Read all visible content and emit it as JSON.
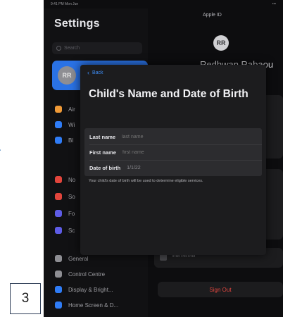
{
  "status_bar": {
    "left": "9:41 PM Mon Jun",
    "right": "•••"
  },
  "sidebar": {
    "title": "Settings",
    "search_placeholder": "Search",
    "profile_initials": "RR",
    "rows_top": [
      {
        "label": "Air",
        "color": "#f09a37"
      },
      {
        "label": "Wi",
        "color": "#2f7cf6"
      },
      {
        "label": "Bl",
        "color": "#2f7cf6"
      }
    ],
    "rows_mid": [
      {
        "label": "No",
        "color": "#e2453c"
      },
      {
        "label": "So",
        "color": "#e2453c"
      },
      {
        "label": "Fo",
        "color": "#5e5ce6"
      },
      {
        "label": "Sc",
        "color": "#5e5ce6"
      }
    ],
    "rows_bottom": [
      {
        "label": "General",
        "color": "#8e8e93"
      },
      {
        "label": "Control Centre",
        "color": "#8e8e93"
      },
      {
        "label": "Display & Bright...",
        "color": "#2f7cf6"
      },
      {
        "label": "Home Screen & D...",
        "color": "#2f7cf6"
      }
    ]
  },
  "detail": {
    "title": "Apple ID",
    "avatar_initials": "RR",
    "name": "Redhwan Rabaou",
    "sign_out": "Sign Out",
    "device": "iPad  This iPad"
  },
  "sheet": {
    "back_label": "Back",
    "title": "Child's Name and Date of Birth",
    "fields": {
      "last_name_label": "Last name",
      "last_name_placeholder": "last name",
      "first_name_label": "First name",
      "first_name_placeholder": "first name",
      "dob_label": "Date of birth",
      "dob_value": "1/1/22"
    },
    "note": "Your child's date of birth will be used to determine eligible services."
  },
  "overlay": {
    "badge_number": "3",
    "partial_char": "t"
  }
}
